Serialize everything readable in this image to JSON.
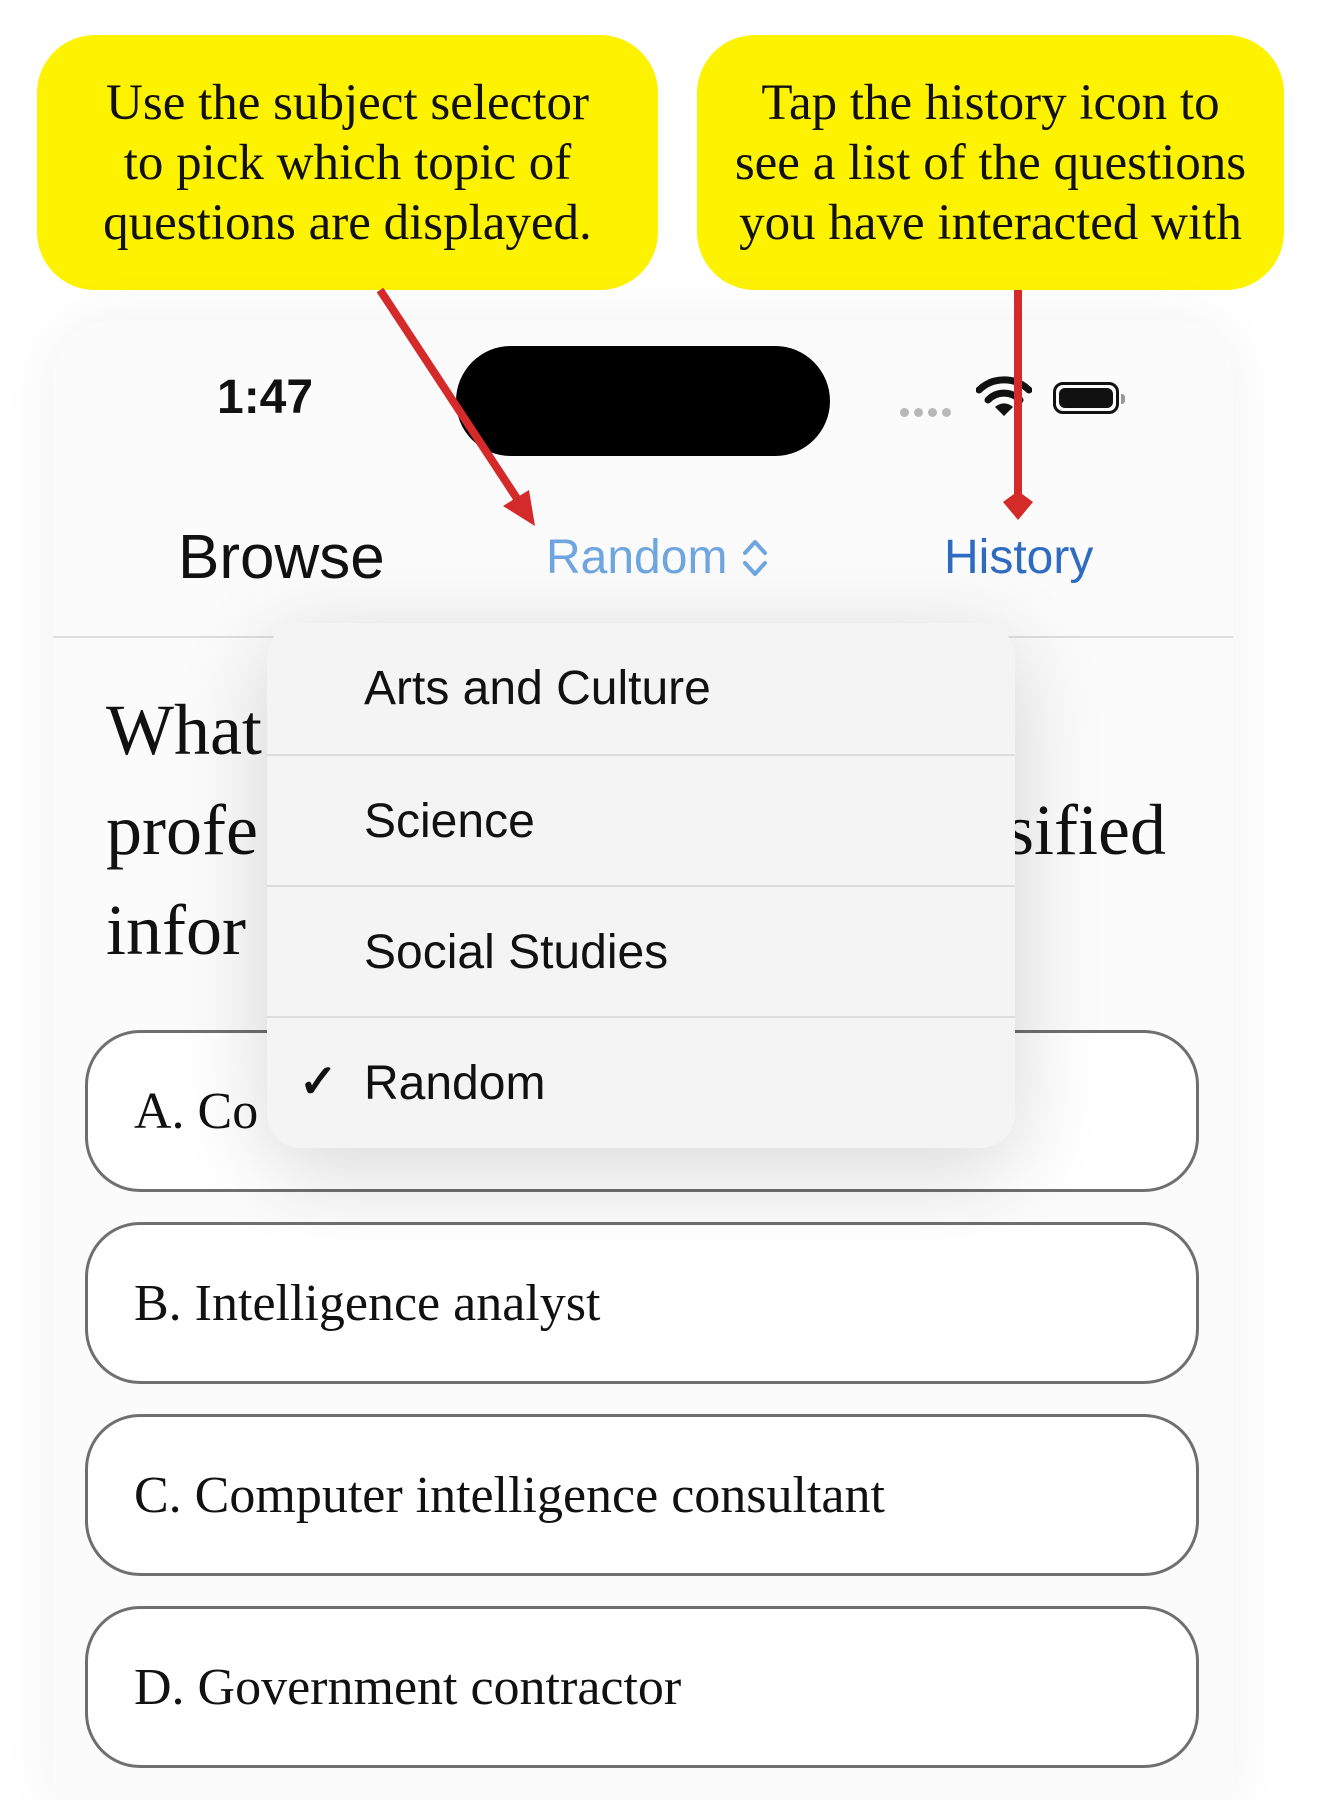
{
  "callouts": {
    "left": "Use the subject selector\nto pick which topic of\nquestions are displayed.",
    "right": "Tap the history icon to\nsee a list of the questions\nyou have interacted with"
  },
  "status_bar": {
    "time": "1:47"
  },
  "nav": {
    "title": "Browse",
    "subject_selector": "Random",
    "history": "History"
  },
  "question": {
    "visible_lines": [
      "What",
      "profe",
      "sified",
      "infor"
    ]
  },
  "answers": [
    {
      "label": "A. Co"
    },
    {
      "label": "B. Intelligence analyst"
    },
    {
      "label": "C. Computer intelligence consultant"
    },
    {
      "label": "D. Government contractor"
    }
  ],
  "dropdown": {
    "items": [
      {
        "label": "Arts and Culture",
        "selected": false
      },
      {
        "label": "Science",
        "selected": false
      },
      {
        "label": "Social Studies",
        "selected": false
      },
      {
        "label": "Random",
        "selected": true
      }
    ],
    "check_glyph": "✓"
  },
  "colors": {
    "callout": "#fdf200",
    "arrow": "#d42a2a",
    "link": "#2f6cc1",
    "selector": "#6fa6e0"
  }
}
